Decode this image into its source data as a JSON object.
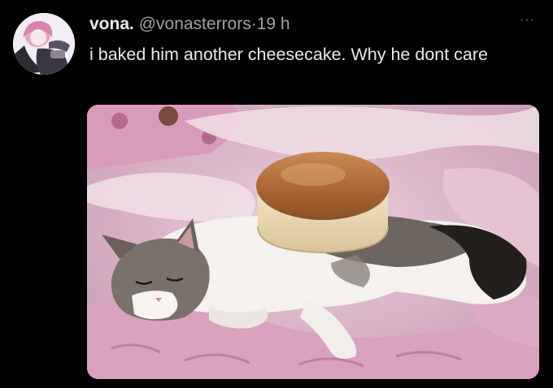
{
  "author": {
    "display_name": "vona.",
    "handle": "@vonasterrors",
    "separator": "·",
    "time": "19 h",
    "avatar_icon": "anime-girl-avatar-icon"
  },
  "more_icon": "ellipsis-icon",
  "more_label": "···",
  "tweet": {
    "text": "i baked him another cheesecake.  Why he dont care"
  },
  "media": {
    "image_icon": "cat-with-cheesecake-photo-icon"
  },
  "colors": {
    "background": "#000000",
    "primary_text": "#e7e9ea",
    "secondary_text": "#9a9fa4",
    "blanket_pink": "#e3b6cf",
    "cheesecake_top": "#b06b3a"
  }
}
